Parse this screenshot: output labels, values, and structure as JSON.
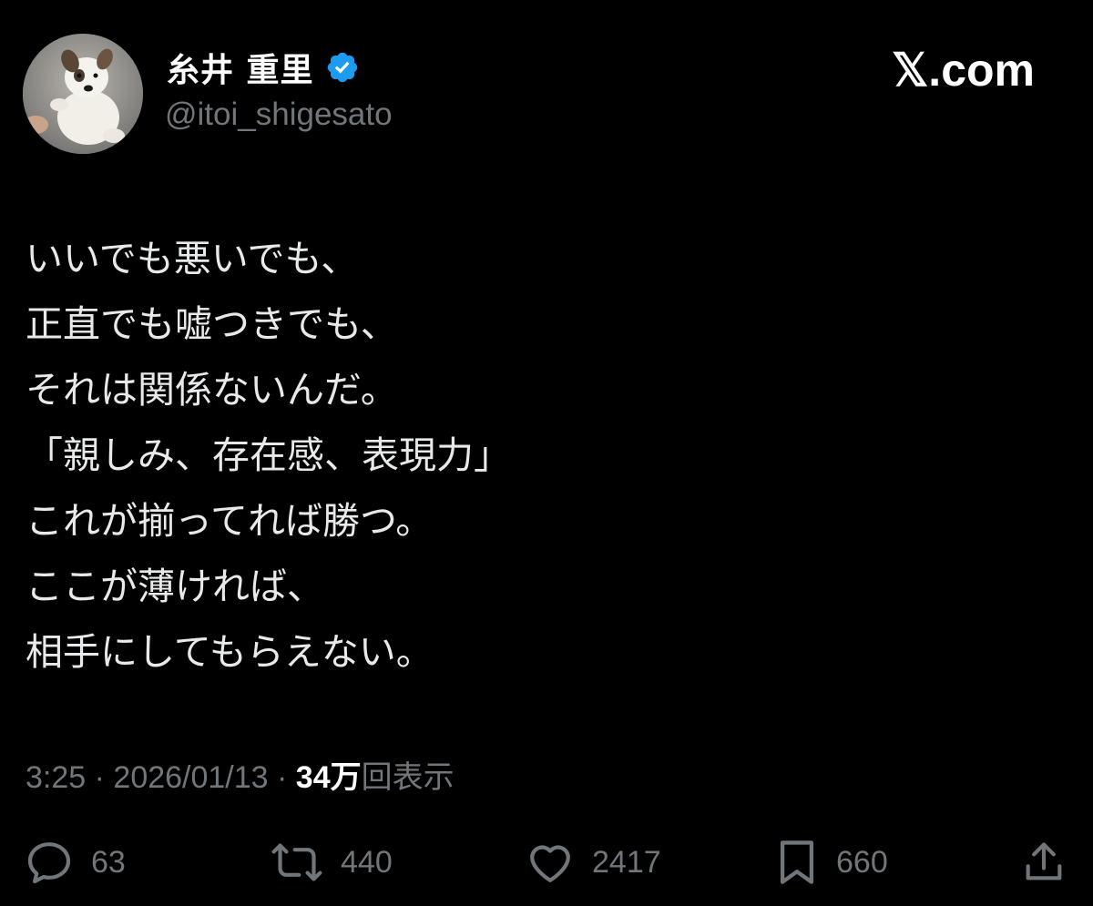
{
  "author": {
    "display_name": "糸井 重里",
    "handle": "@itoi_shigesato",
    "verified": true,
    "verified_color": "#1d9bf0"
  },
  "brand": {
    "label": "𝕏.com"
  },
  "tweet": {
    "lines": [
      "いいでも悪いでも、",
      "正直でも嘘つきでも、",
      "それは関係ないんだ。",
      "「親しみ、存在感、表現力」",
      "これが揃ってれば勝つ。",
      "ここが薄ければ、",
      "相手にしてもらえない。"
    ]
  },
  "meta": {
    "time": "3:25",
    "separator": " · ",
    "date": "2026/01/13",
    "views_count": "34万",
    "views_label": "回表示"
  },
  "actions": {
    "reply": {
      "icon": "reply-icon",
      "count": "63"
    },
    "repost": {
      "icon": "repost-icon",
      "count": "440"
    },
    "like": {
      "icon": "heart-icon",
      "count": "2417"
    },
    "bookmark": {
      "icon": "bookmark-icon",
      "count": "660"
    },
    "share": {
      "icon": "share-icon"
    }
  },
  "colors": {
    "background": "#000000",
    "primary_text": "#e7e9ea",
    "secondary_text": "#71767b"
  }
}
